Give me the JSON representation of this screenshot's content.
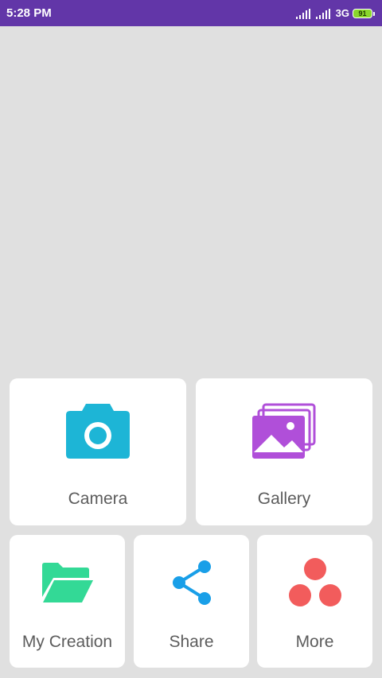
{
  "status_bar": {
    "time": "5:28 PM",
    "network": "3G",
    "battery": "91"
  },
  "menu": {
    "camera": {
      "label": "Camera",
      "icon": "camera-icon",
      "color": "#1db5d6"
    },
    "gallery": {
      "label": "Gallery",
      "icon": "gallery-icon",
      "color": "#b04fd9"
    },
    "my_creation": {
      "label": "My Creation",
      "icon": "folder-icon",
      "color": "#33d996"
    },
    "share": {
      "label": "Share",
      "icon": "share-icon",
      "color": "#199fe8"
    },
    "more": {
      "label": "More",
      "icon": "more-icon",
      "color": "#f25c5c"
    }
  },
  "colors": {
    "status_bar": "#6236a8",
    "background": "#e0e0e0"
  }
}
